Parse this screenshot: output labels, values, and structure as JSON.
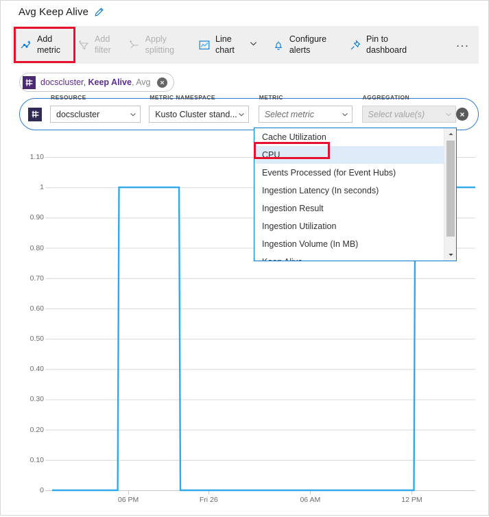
{
  "header": {
    "title": "Avg Keep Alive",
    "edit_icon": "pencil-icon"
  },
  "toolbar": {
    "buttons": [
      {
        "name": "add-metric",
        "icon": "add-metric-icon",
        "line1": "Add",
        "line2": "metric",
        "disabled": false
      },
      {
        "name": "add-filter",
        "icon": "add-filter-icon",
        "line1": "Add",
        "line2": "filter",
        "disabled": true
      },
      {
        "name": "apply-splitting",
        "icon": "apply-splitting-icon",
        "line1": "Apply",
        "line2": "splitting",
        "disabled": true
      },
      {
        "name": "line-chart",
        "icon": "line-chart-icon",
        "line1": "Line",
        "line2": "chart",
        "disabled": false
      },
      {
        "name": "configure-alerts",
        "icon": "bell-icon",
        "line1": "Configure",
        "line2": "alerts",
        "disabled": false
      },
      {
        "name": "pin-to-dashboard",
        "icon": "pin-icon",
        "line1": "Pin to",
        "line2": "dashboard",
        "disabled": false
      }
    ],
    "chevron_icon": "chevron-down-icon",
    "overflow_label": "...",
    "highlight_color": "#e8112d"
  },
  "chip": {
    "icon": "metric-chip-icon",
    "resource": "docscluster, ",
    "metric": "Keep Alive",
    "aggregation": ", Avg",
    "close_icon": "close-icon",
    "accent_color": "#5c2d91"
  },
  "selector": {
    "icon": "metric-selector-icon",
    "fields": [
      {
        "label": "RESOURCE",
        "value": "docscluster",
        "placeholder": false,
        "disabled": false
      },
      {
        "label": "METRIC NAMESPACE",
        "value": "Kusto Cluster stand...",
        "placeholder": false,
        "disabled": false
      },
      {
        "label": "METRIC",
        "value": "Select metric",
        "placeholder": true,
        "disabled": false
      },
      {
        "label": "AGGREGATION",
        "value": "Select value(s)",
        "placeholder": true,
        "disabled": true
      }
    ],
    "close_icon": "close-icon",
    "border_color": "#2c7cd6"
  },
  "dropdown": {
    "options": [
      "Cache Utilization",
      "CPU",
      "Events Processed (for Event Hubs)",
      "Ingestion Latency (In seconds)",
      "Ingestion Result",
      "Ingestion Utilization",
      "Ingestion Volume (In MB)",
      "Keep Alive"
    ],
    "selected": "CPU",
    "scroll_up_icon": "scroll-up-icon",
    "scroll_down_icon": "scroll-down-icon",
    "selected_bg": "#deecf9"
  },
  "chart_data": {
    "type": "line",
    "title": "Avg Keep Alive",
    "xlabel": "",
    "ylabel": "",
    "grid": true,
    "legend": "none",
    "line_color": "#32a8e8",
    "ylim": [
      0,
      1.1
    ],
    "yticks": [
      "1.10",
      "1",
      "0.90",
      "0.80",
      "0.70",
      "0.60",
      "0.50",
      "0.40",
      "0.30",
      "0.20",
      "0.10",
      "0"
    ],
    "ytick_values": [
      1.1,
      1.0,
      0.9,
      0.8,
      0.7,
      0.6,
      0.5,
      0.4,
      0.3,
      0.2,
      0.1,
      0
    ],
    "xticks": [
      "06 PM",
      "Fri 26",
      "06 AM",
      "12 PM"
    ],
    "xtick_positions": [
      0.18,
      0.37,
      0.61,
      0.85
    ],
    "series": [
      {
        "name": "docscluster, Keep Alive, Avg",
        "x": [
          0.0,
          0.155,
          0.158,
          0.3,
          0.303,
          0.855,
          0.858,
          1.0
        ],
        "values": [
          0,
          0,
          1,
          1,
          0,
          0,
          1,
          1
        ]
      }
    ]
  }
}
